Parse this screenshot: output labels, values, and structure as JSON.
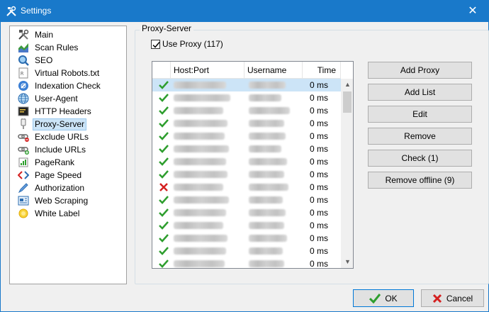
{
  "window": {
    "title": "Settings",
    "close_glyph": "✕"
  },
  "sidebar": {
    "items": [
      {
        "label": "Main",
        "icon": "tools-icon"
      },
      {
        "label": "Scan Rules",
        "icon": "chart-icon"
      },
      {
        "label": "SEO",
        "icon": "magnifier-icon"
      },
      {
        "label": "Virtual Robots.txt",
        "icon": "robots-file-icon"
      },
      {
        "label": "Indexation Check",
        "icon": "index-icon"
      },
      {
        "label": "User-Agent",
        "icon": "globe-icon"
      },
      {
        "label": "HTTP Headers",
        "icon": "terminal-icon"
      },
      {
        "label": "Proxy-Server",
        "icon": "plug-icon"
      },
      {
        "label": "Exclude URLs",
        "icon": "link-minus-icon"
      },
      {
        "label": "Include URLs",
        "icon": "link-plus-icon"
      },
      {
        "label": "PageRank",
        "icon": "pagerank-icon"
      },
      {
        "label": "Page Speed",
        "icon": "code-icon"
      },
      {
        "label": "Authorization",
        "icon": "pen-icon"
      },
      {
        "label": "Web Scraping",
        "icon": "scraping-icon"
      },
      {
        "label": "White Label",
        "icon": "sun-icon"
      }
    ],
    "selected": "Proxy-Server"
  },
  "proxy": {
    "group_title": "Proxy-Server",
    "use_proxy_label": "Use Proxy (117)",
    "use_proxy_checked": true,
    "columns": [
      "",
      "Host:Port",
      "Username",
      "Time"
    ],
    "rows": [
      {
        "status": "ok",
        "time": "0 ms"
      },
      {
        "status": "ok",
        "time": "0 ms"
      },
      {
        "status": "ok",
        "time": "0 ms"
      },
      {
        "status": "ok",
        "time": "0 ms"
      },
      {
        "status": "ok",
        "time": "0 ms"
      },
      {
        "status": "ok",
        "time": "0 ms"
      },
      {
        "status": "ok",
        "time": "0 ms"
      },
      {
        "status": "ok",
        "time": "0 ms"
      },
      {
        "status": "fail",
        "time": "0 ms"
      },
      {
        "status": "ok",
        "time": "0 ms"
      },
      {
        "status": "ok",
        "time": "0 ms"
      },
      {
        "status": "ok",
        "time": "0 ms"
      },
      {
        "status": "ok",
        "time": "0 ms"
      },
      {
        "status": "ok",
        "time": "0 ms"
      },
      {
        "status": "ok",
        "time": "0 ms"
      }
    ],
    "buttons": {
      "add_proxy": "Add Proxy",
      "add_list": "Add List",
      "edit": "Edit",
      "remove": "Remove",
      "check": "Check (1)",
      "remove_offline": "Remove offline (9)"
    }
  },
  "footer": {
    "ok": "OK",
    "cancel": "Cancel"
  },
  "colors": {
    "titlebar": "#1979ca",
    "selection": "#cce4f7",
    "ok_green": "#2e9e2e",
    "fail_red": "#d42020"
  }
}
